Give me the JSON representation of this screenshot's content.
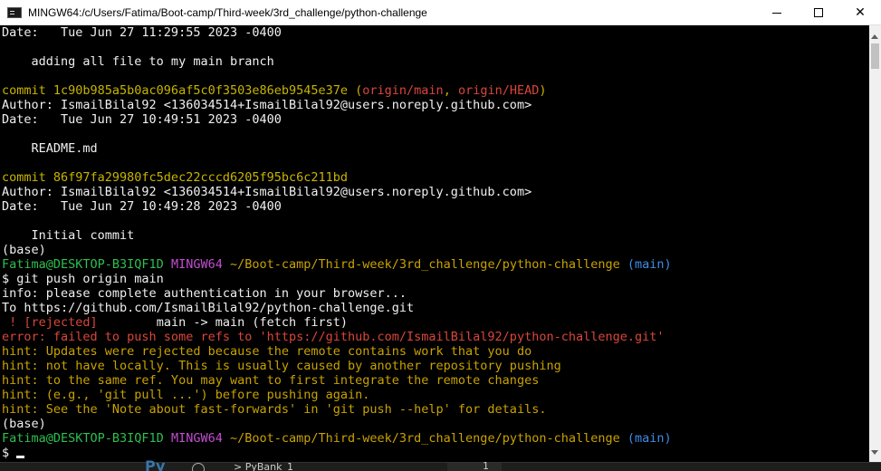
{
  "window": {
    "title": "MINGW64:/c/Users/Fatima/Boot-camp/Third-week/3rd_challenge/python-challenge",
    "minimize_label": "",
    "maximize_label": "",
    "close_label": "✕"
  },
  "terminal": {
    "lines": [
      [
        {
          "t": "Date:   Tue Jun 27 11:29:55 2023 -0400",
          "c": "white"
        }
      ],
      [
        {
          "t": "",
          "c": "white"
        }
      ],
      [
        {
          "t": "    adding all file to my main branch",
          "c": "white"
        }
      ],
      [
        {
          "t": "",
          "c": "white"
        }
      ],
      [
        {
          "t": "commit 1c90b985a5b0ac096af5c0f3503e86eb9545e37e ",
          "c": "yellow"
        },
        {
          "t": "(",
          "c": "yellow"
        },
        {
          "t": "origin/main",
          "c": "red"
        },
        {
          "t": ", ",
          "c": "yellow"
        },
        {
          "t": "origin/HEAD",
          "c": "red"
        },
        {
          "t": ")",
          "c": "yellow"
        }
      ],
      [
        {
          "t": "Author: IsmailBilal92 <136034514+IsmailBilal92@users.noreply.github.com>",
          "c": "white"
        }
      ],
      [
        {
          "t": "Date:   Tue Jun 27 10:49:51 2023 -0400",
          "c": "white"
        }
      ],
      [
        {
          "t": "",
          "c": "white"
        }
      ],
      [
        {
          "t": "    README.md",
          "c": "white"
        }
      ],
      [
        {
          "t": "",
          "c": "white"
        }
      ],
      [
        {
          "t": "commit 86f97fa29980fc5dec22cccd6205f95bc6c211bd",
          "c": "yellow"
        }
      ],
      [
        {
          "t": "Author: IsmailBilal92 <136034514+IsmailBilal92@users.noreply.github.com>",
          "c": "white"
        }
      ],
      [
        {
          "t": "Date:   Tue Jun 27 10:49:28 2023 -0400",
          "c": "white"
        }
      ],
      [
        {
          "t": "",
          "c": "white"
        }
      ],
      [
        {
          "t": "    Initial commit",
          "c": "white"
        }
      ],
      [
        {
          "t": "(base)",
          "c": "white"
        }
      ],
      [
        {
          "t": "Fatima@DESKTOP-B3IQF1D ",
          "c": "green"
        },
        {
          "t": "MINGW64 ",
          "c": "magenta"
        },
        {
          "t": "~/Boot-camp/Third-week/3rd_challenge/python-challenge ",
          "c": "gold"
        },
        {
          "t": "(main)",
          "c": "blue"
        }
      ],
      [
        {
          "t": "$ git push origin main",
          "c": "white"
        }
      ],
      [
        {
          "t": "info: please complete authentication in your browser...",
          "c": "white"
        }
      ],
      [
        {
          "t": "To https://github.com/IsmailBilal92/python-challenge.git",
          "c": "white"
        }
      ],
      [
        {
          "t": " ! [rejected]        ",
          "c": "red"
        },
        {
          "t": "main -> main (fetch first)",
          "c": "white"
        }
      ],
      [
        {
          "t": "error: failed to push some refs to 'https://github.com/IsmailBilal92/python-challenge.git'",
          "c": "red"
        }
      ],
      [
        {
          "t": "hint: Updates were rejected because the remote contains work that you do",
          "c": "gold"
        }
      ],
      [
        {
          "t": "hint: not have locally. This is usually caused by another repository pushing",
          "c": "gold"
        }
      ],
      [
        {
          "t": "hint: to the same ref. You may want to first integrate the remote changes",
          "c": "gold"
        }
      ],
      [
        {
          "t": "hint: (e.g., 'git pull ...') before pushing again.",
          "c": "gold"
        }
      ],
      [
        {
          "t": "hint: See the 'Note about fast-forwards' in 'git push --help' for details.",
          "c": "gold"
        }
      ],
      [
        {
          "t": "(base)",
          "c": "white"
        }
      ],
      [
        {
          "t": "Fatima@DESKTOP-B3IQF1D ",
          "c": "green"
        },
        {
          "t": "MINGW64 ",
          "c": "magenta"
        },
        {
          "t": "~/Boot-camp/Third-week/3rd_challenge/python-challenge ",
          "c": "gold"
        },
        {
          "t": "(main)",
          "c": "blue"
        }
      ],
      [
        {
          "t": "$",
          "c": "white"
        }
      ]
    ]
  },
  "taskbar": {
    "logo_glyph": "Py",
    "tab_label": "> PyBank_1",
    "line_number": "1"
  },
  "colors": {
    "yellow": "#c8b400",
    "red": "#d9463b",
    "green": "#2dbf4f",
    "magenta": "#c34ed1",
    "blue": "#3f8ce8",
    "gold": "#c8a200",
    "white": "#f0f0f0"
  },
  "icons": {
    "app": "terminal-app-icon",
    "minimize": "minimize-icon",
    "maximize": "maximize-icon",
    "close": "close-icon"
  }
}
